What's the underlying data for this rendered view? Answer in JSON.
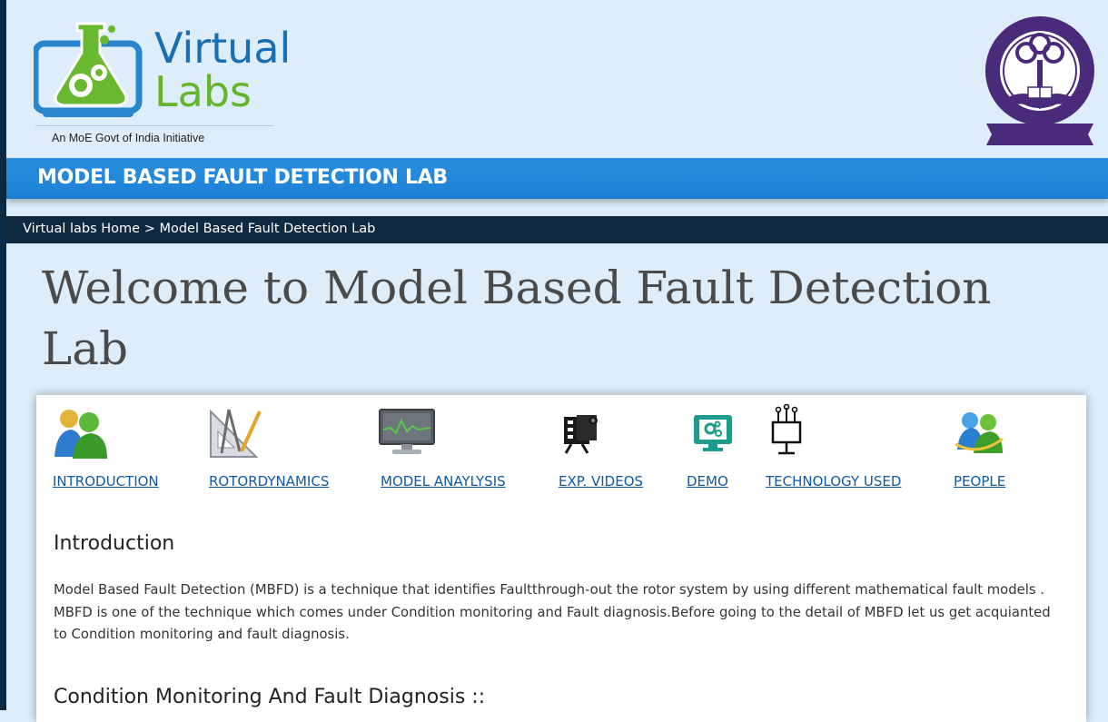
{
  "header": {
    "logo": {
      "word1": "Virtual",
      "word2": "Labs",
      "tagline": "An MoE Govt of India Initiative"
    },
    "seal_icon": "iit-kharagpur-seal"
  },
  "title_bar": {
    "text": "MODEL BASED FAULT DETECTION LAB"
  },
  "breadcrumb": {
    "text": "Virtual labs Home > Model Based Fault Detection Lab"
  },
  "page_title": "Welcome to Model Based Fault Detection Lab",
  "nav": [
    {
      "label": "INTRODUCTION",
      "icon": "users-icon"
    },
    {
      "label": "ROTORDYNAMICS",
      "icon": "drafting-tools-icon"
    },
    {
      "label": "MODEL ANAYLYSIS",
      "icon": "monitor-graph-icon"
    },
    {
      "label": "EXP. VIDEOS",
      "icon": "video-camera-icon"
    },
    {
      "label": "DEMO",
      "icon": "demo-screen-icon"
    },
    {
      "label": "TECHNOLOGY USED",
      "icon": "circuit-chip-icon"
    },
    {
      "label": "PEOPLE",
      "icon": "people-icon"
    }
  ],
  "main": {
    "intro_heading": "Introduction",
    "intro_text": "Model Based Fault Detection (MBFD) is a technique that identifies Faultthrough-out the rotor system by using different mathematical fault models . MBFD is one of the technique which comes under Condition monitoring and Fault diagnosis.Before going to the detail of MBFD let us get acquianted to Condition monitoring and fault diagnosis.",
    "cm_heading": "Condition Monitoring And Fault Diagnosis ::"
  },
  "colors": {
    "page_bg": "#ddeefa",
    "title_bar": "#1b7fd4",
    "breadcrumb_bar": "#0f2940",
    "link": "#0f5aa8",
    "logo_blue": "#1a6fb3",
    "logo_green": "#66b32e"
  }
}
